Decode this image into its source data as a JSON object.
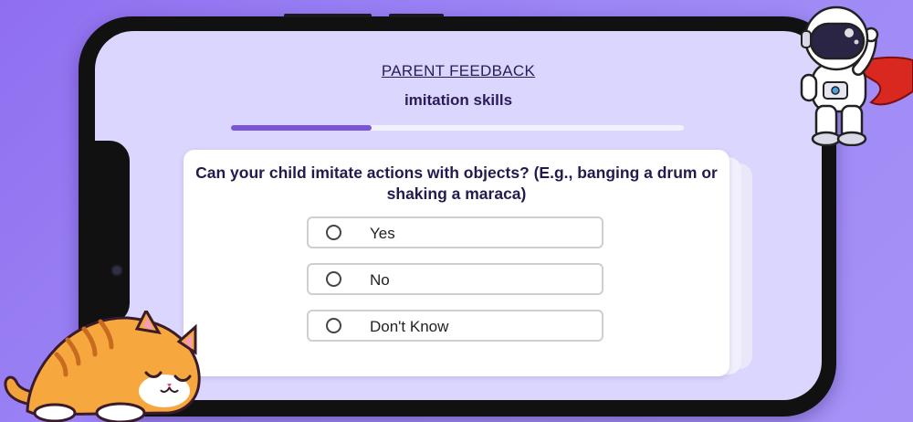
{
  "header": {
    "title": "PARENT FEEDBACK",
    "subtitle": "imitation skills"
  },
  "progress": {
    "fraction": 0.31
  },
  "question": {
    "text": "Can your child imitate actions with objects? (E.g., banging a drum or shaking a maraca)"
  },
  "options": [
    {
      "label": "Yes"
    },
    {
      "label": "No"
    },
    {
      "label": "Don't Know"
    }
  ],
  "illustrations": {
    "top_right": "astronaut-illustration",
    "bottom_left": "sleeping-cat-illustration"
  },
  "colors": {
    "background": "#9d86f5",
    "screen": "#dad6fd",
    "accent": "#7a55d8",
    "text": "#241a4e"
  }
}
